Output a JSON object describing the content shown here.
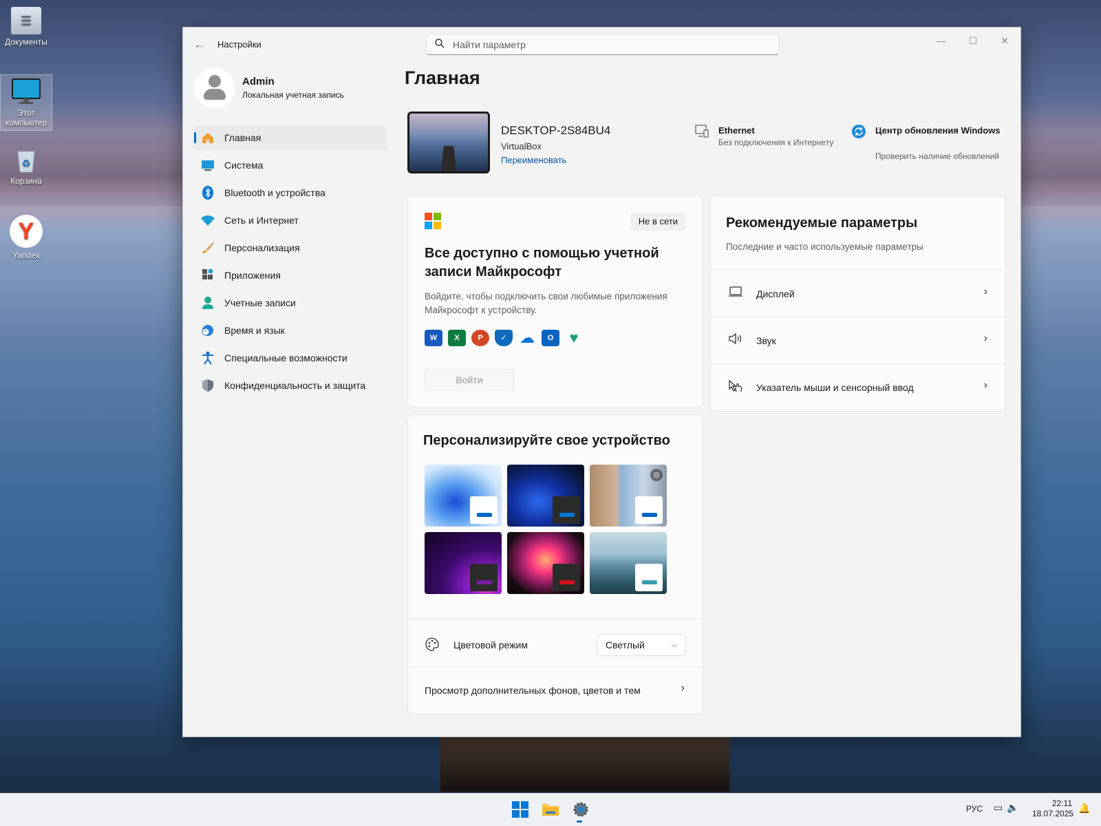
{
  "desktop": {
    "icons": [
      {
        "label": "Документы",
        "icon": "documents-folder-icon"
      },
      {
        "label": "Этот компьютер",
        "icon": "this-pc-icon"
      },
      {
        "label": "Корзина",
        "icon": "recycle-bin-icon"
      },
      {
        "label": "Yandex",
        "icon": "yandex-browser-icon"
      }
    ]
  },
  "window": {
    "app_title": "Настройки",
    "search_placeholder": "Найти параметр"
  },
  "profile": {
    "name": "Admin",
    "account_type": "Локальная учетная запись"
  },
  "nav": {
    "items": [
      {
        "label": "Главная",
        "icon": "home-icon",
        "active": true
      },
      {
        "label": "Система",
        "icon": "system-icon"
      },
      {
        "label": "Bluetooth и устройства",
        "icon": "bluetooth-icon"
      },
      {
        "label": "Сеть и Интернет",
        "icon": "wifi-icon"
      },
      {
        "label": "Персонализация",
        "icon": "brush-icon"
      },
      {
        "label": "Приложения",
        "icon": "apps-icon"
      },
      {
        "label": "Учетные записи",
        "icon": "accounts-icon"
      },
      {
        "label": "Время и язык",
        "icon": "time-language-icon"
      },
      {
        "label": "Специальные возможности",
        "icon": "accessibility-icon"
      },
      {
        "label": "Конфиденциальность и защита",
        "icon": "shield-icon"
      }
    ]
  },
  "main": {
    "page_title": "Главная",
    "device": {
      "name": "DESKTOP-2S84BU4",
      "model": "VirtualBox",
      "rename_link": "Переименовать"
    },
    "status": {
      "network": {
        "title": "Ethernet",
        "subtitle": "Без подключения к Интернету"
      },
      "update": {
        "title": "Центр обновления Windows",
        "subtitle": "Проверить наличие обновлений"
      }
    },
    "ms_account_card": {
      "badge": "Не в сети",
      "heading": "Все доступно с помощью учетной записи Майкрософт",
      "description": "Войдите, чтобы подключить свои любимые приложения Майкрософт к устройству.",
      "apps": [
        "word-icon",
        "excel-icon",
        "powerpoint-icon",
        "defender-icon",
        "onedrive-icon",
        "outlook-icon",
        "family-icon"
      ],
      "signin_button": "Войти"
    },
    "personalize_card": {
      "heading": "Персонализируйте свое устройство",
      "themes": [
        {
          "name": "windows-light-theme",
          "accent": "#0067c0"
        },
        {
          "name": "windows-dark-theme",
          "accent": "#0078d4"
        },
        {
          "name": "spotlight-theme",
          "accent": "#0067c0"
        },
        {
          "name": "glow-theme",
          "accent": "#7a1fa2"
        },
        {
          "name": "captured-motion-theme",
          "accent": "#d40f1f"
        },
        {
          "name": "flow-theme",
          "accent": "#3a9ab0"
        }
      ],
      "color_mode_label": "Цветовой режим",
      "color_mode_value": "Светлый",
      "more_link": "Просмотр дополнительных фонов, цветов и тем"
    },
    "recommended_card": {
      "heading": "Рекомендуемые параметры",
      "subtitle": "Последние и часто используемые параметры",
      "items": [
        {
          "label": "Дисплей",
          "icon": "display-icon"
        },
        {
          "label": "Звук",
          "icon": "speaker-icon"
        },
        {
          "label": "Указатель мыши и сенсорный ввод",
          "icon": "touch-pointer-icon"
        }
      ]
    }
  },
  "taskbar": {
    "language": "РУС",
    "time": "22:11",
    "date": "18.07.2025"
  },
  "colors": {
    "accent": "#0067c0",
    "window_bg": "#f3f3f3",
    "card_bg": "#fbfbfb"
  }
}
